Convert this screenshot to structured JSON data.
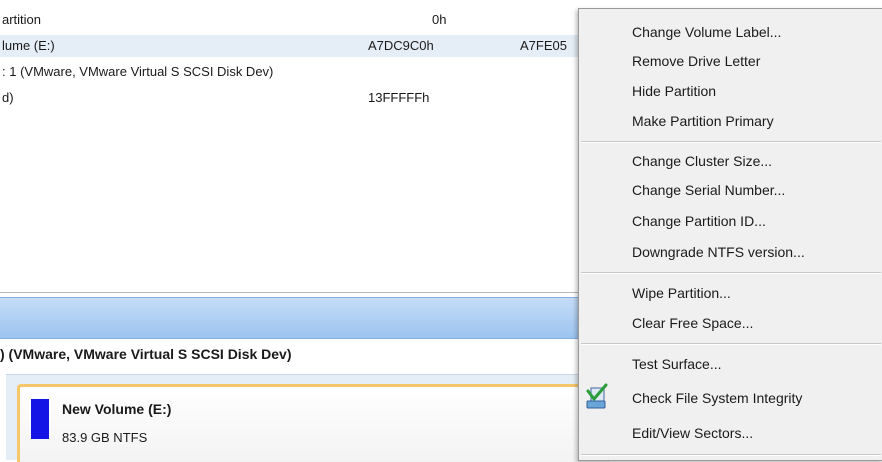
{
  "partition_table": {
    "rows": [
      {
        "name": "artition",
        "start": "0h",
        "end": ""
      },
      {
        "name": "lume (E:)",
        "start": "A7DC9C0h",
        "end": "A7FE05"
      },
      {
        "name": ": 1 (VMware, VMware Virtual S SCSI Disk Dev)",
        "start": "",
        "end": ""
      },
      {
        "name": "d)",
        "start": "13FFFFFh",
        "end": ""
      }
    ]
  },
  "disk_map": {
    "disk_title": ") (VMware, VMware Virtual S SCSI Disk Dev)",
    "volume": {
      "name": "New Volume (E:)",
      "size_fs": "83.9 GB NTFS",
      "color": "#1414e6"
    }
  },
  "context_menu": {
    "groups": [
      [
        "Change Volume Label...",
        "Remove Drive Letter",
        "Hide Partition",
        "Make Partition Primary"
      ],
      [
        "Change Cluster Size...",
        "Change Serial Number...",
        "Change Partition ID...",
        "Downgrade NTFS version..."
      ],
      [
        "Wipe Partition...",
        "Clear Free Space..."
      ],
      [
        "Test Surface...",
        "Check File System Integrity",
        "Edit/View Sectors..."
      ]
    ],
    "check_icon": "check-disk-icon"
  }
}
